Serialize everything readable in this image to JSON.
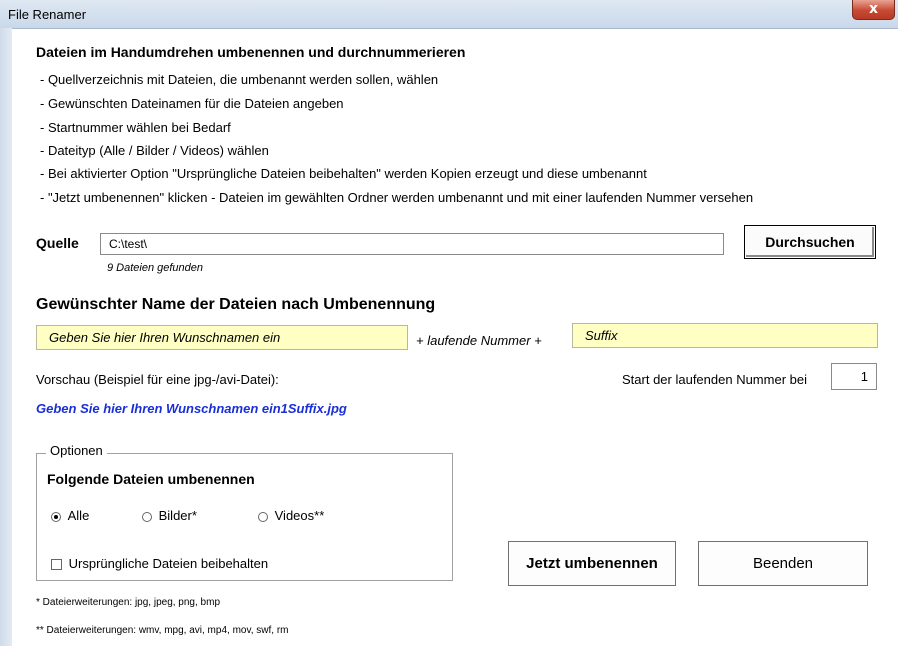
{
  "window": {
    "title": "File Renamer",
    "close_glyph": "x"
  },
  "intro": {
    "heading": "Dateien im Handumdrehen umbenennen und durchnummerieren",
    "bullets": [
      "- Quellverzeichnis mit Dateien, die umbenannt werden sollen, wählen",
      "- Gewünschten Dateinamen für die Dateien angeben",
      "- Startnummer wählen bei Bedarf",
      "- Dateityp (Alle / Bilder / Videos) wählen",
      "- Bei aktivierter Option \"Ursprüngliche Dateien beibehalten\" werden Kopien erzeugt und diese umbenannt",
      "- \"Jetzt umbenennen\" klicken - Dateien im gewählten Ordner werden umbenannt und mit einer laufenden Nummer versehen"
    ]
  },
  "source": {
    "label": "Quelle",
    "path": "C:\\test\\",
    "found_text": "9 Dateien gefunden",
    "browse_label": "Durchsuchen"
  },
  "naming": {
    "heading": "Gewünschter Name der Dateien nach Umbenennung",
    "name_value": "Geben Sie hier Ihren Wunschnamen ein",
    "plus_text": "+ laufende Nummer +",
    "suffix_value": "Suffix",
    "preview_label": "Vorschau (Beispiel für eine jpg-/avi-Datei):",
    "preview_value": "Geben Sie hier Ihren Wunschnamen ein1Suffix.jpg",
    "start_label": "Start der laufenden Nummer bei",
    "start_value": "1"
  },
  "options": {
    "legend": "Optionen",
    "heading": "Folgende Dateien umbenennen",
    "radio_all": "Alle",
    "radio_images": "Bilder*",
    "radio_videos": "Videos**",
    "selected": "Alle",
    "keep_originals_label": "Ursprüngliche Dateien beibehalten",
    "keep_originals_checked": false
  },
  "actions": {
    "rename_label": "Jetzt umbenennen",
    "exit_label": "Beenden"
  },
  "footnotes": {
    "images": "* Dateierweiterungen: jpg, jpeg, png, bmp",
    "videos": "** Dateierweiterungen: wmv, mpg, avi, mp4, mov, swf, rm"
  },
  "colors": {
    "preview_text": "#1a2fd6",
    "input_yellow": "#ffffc4",
    "close_red": "#c74a33"
  }
}
